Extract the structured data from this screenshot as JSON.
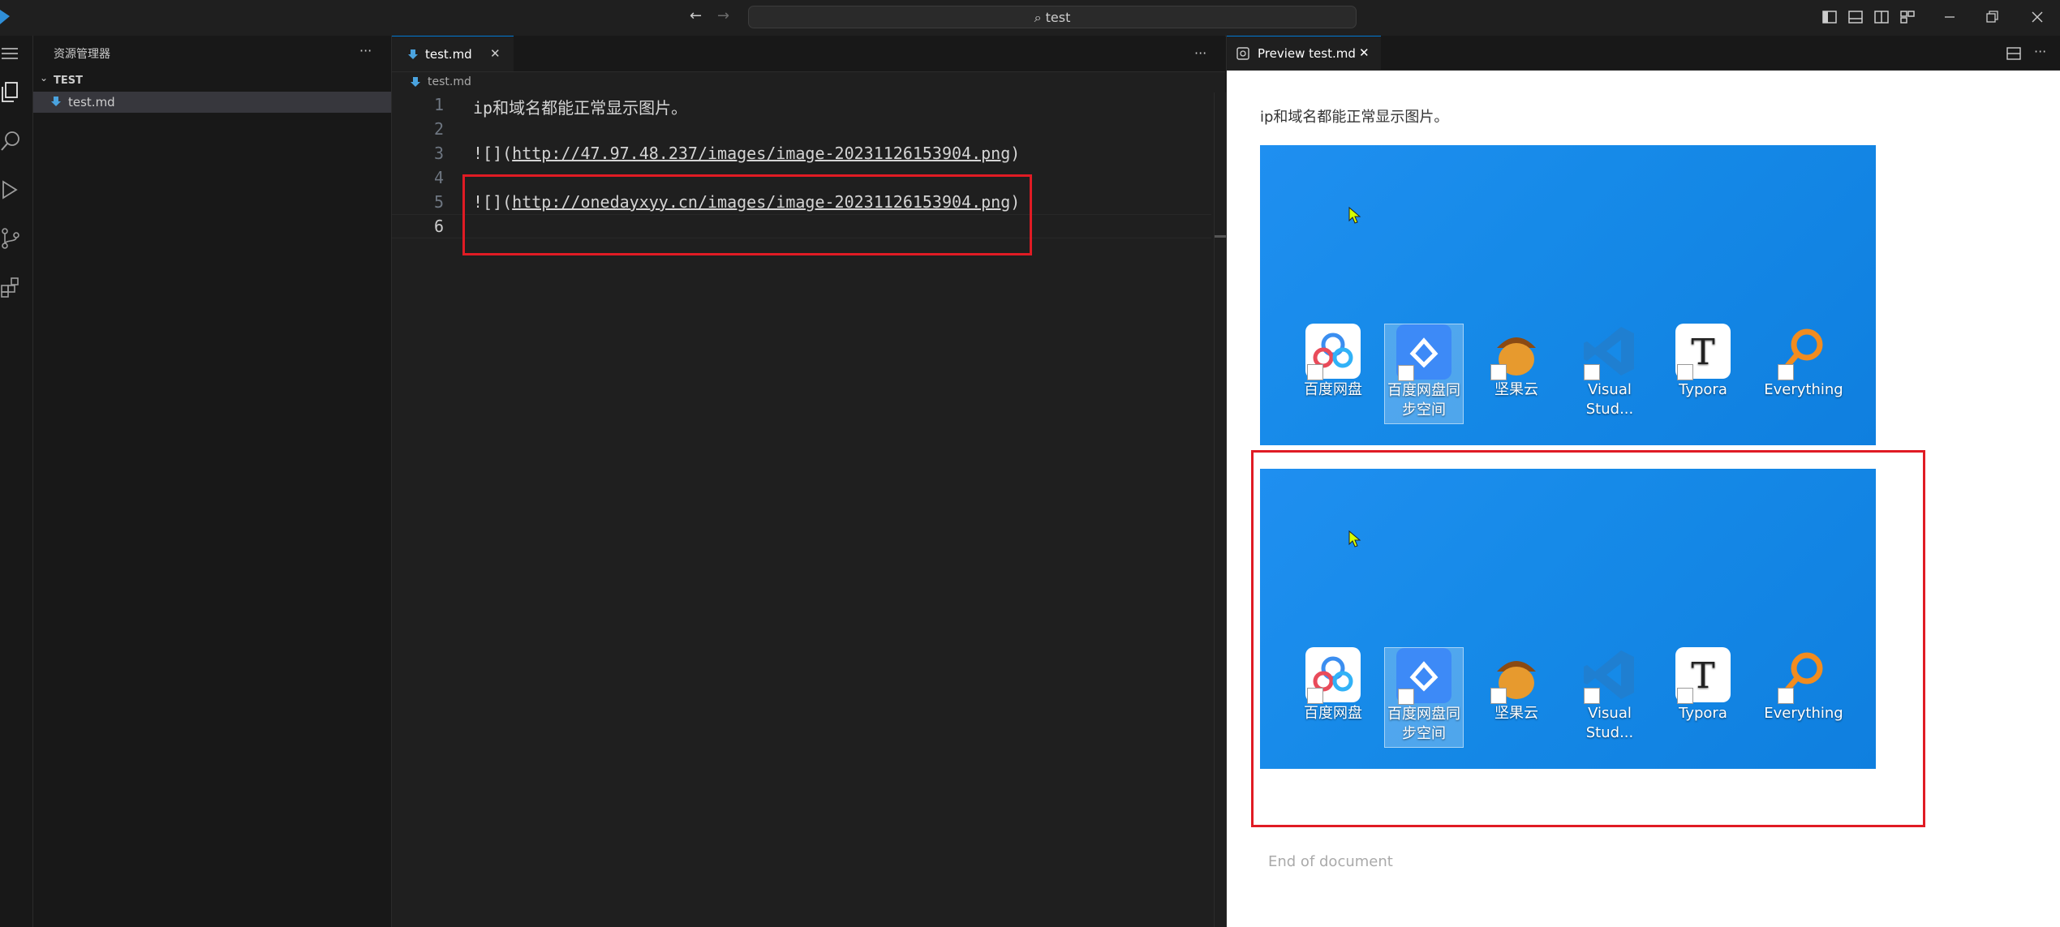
{
  "titlebar": {
    "search_text": "test"
  },
  "explorer": {
    "title": "资源管理器",
    "more": "···",
    "folder": "TEST",
    "file": "test.md"
  },
  "editor": {
    "tab_label": "test.md",
    "tab_close": "✕",
    "more": "···",
    "breadcrumb": "test.md",
    "lines": [
      {
        "num": "1",
        "text": "ip和域名都能正常显示图片。"
      },
      {
        "num": "2",
        "text": ""
      },
      {
        "num": "3",
        "prefix": "![](",
        "url": "http://47.97.48.237/images/image-20231126153904.png",
        "suffix": ")"
      },
      {
        "num": "4",
        "text": ""
      },
      {
        "num": "5",
        "prefix": "![](",
        "url": "http://onedayxyy.cn/images/image-20231126153904.png",
        "suffix": ")"
      },
      {
        "num": "6",
        "text": ""
      }
    ]
  },
  "preview": {
    "tab_label": "Preview test.md",
    "tab_close": "✕",
    "paragraph": "ip和域名都能正常显示图片。",
    "end_text": "End of document",
    "desktop_icons": [
      {
        "label": "百度网盘",
        "label2": ""
      },
      {
        "label": "百度网盘同",
        "label2": "步空间"
      },
      {
        "label": "坚果云",
        "label2": ""
      },
      {
        "label": "Visual",
        "label2": "Stud..."
      },
      {
        "label": "Typora",
        "label2": ""
      },
      {
        "label": "Everything",
        "label2": ""
      }
    ]
  },
  "colors": {
    "accent": "#0078d4",
    "highlight": "#e01b24",
    "desktop": "#168ae8"
  }
}
